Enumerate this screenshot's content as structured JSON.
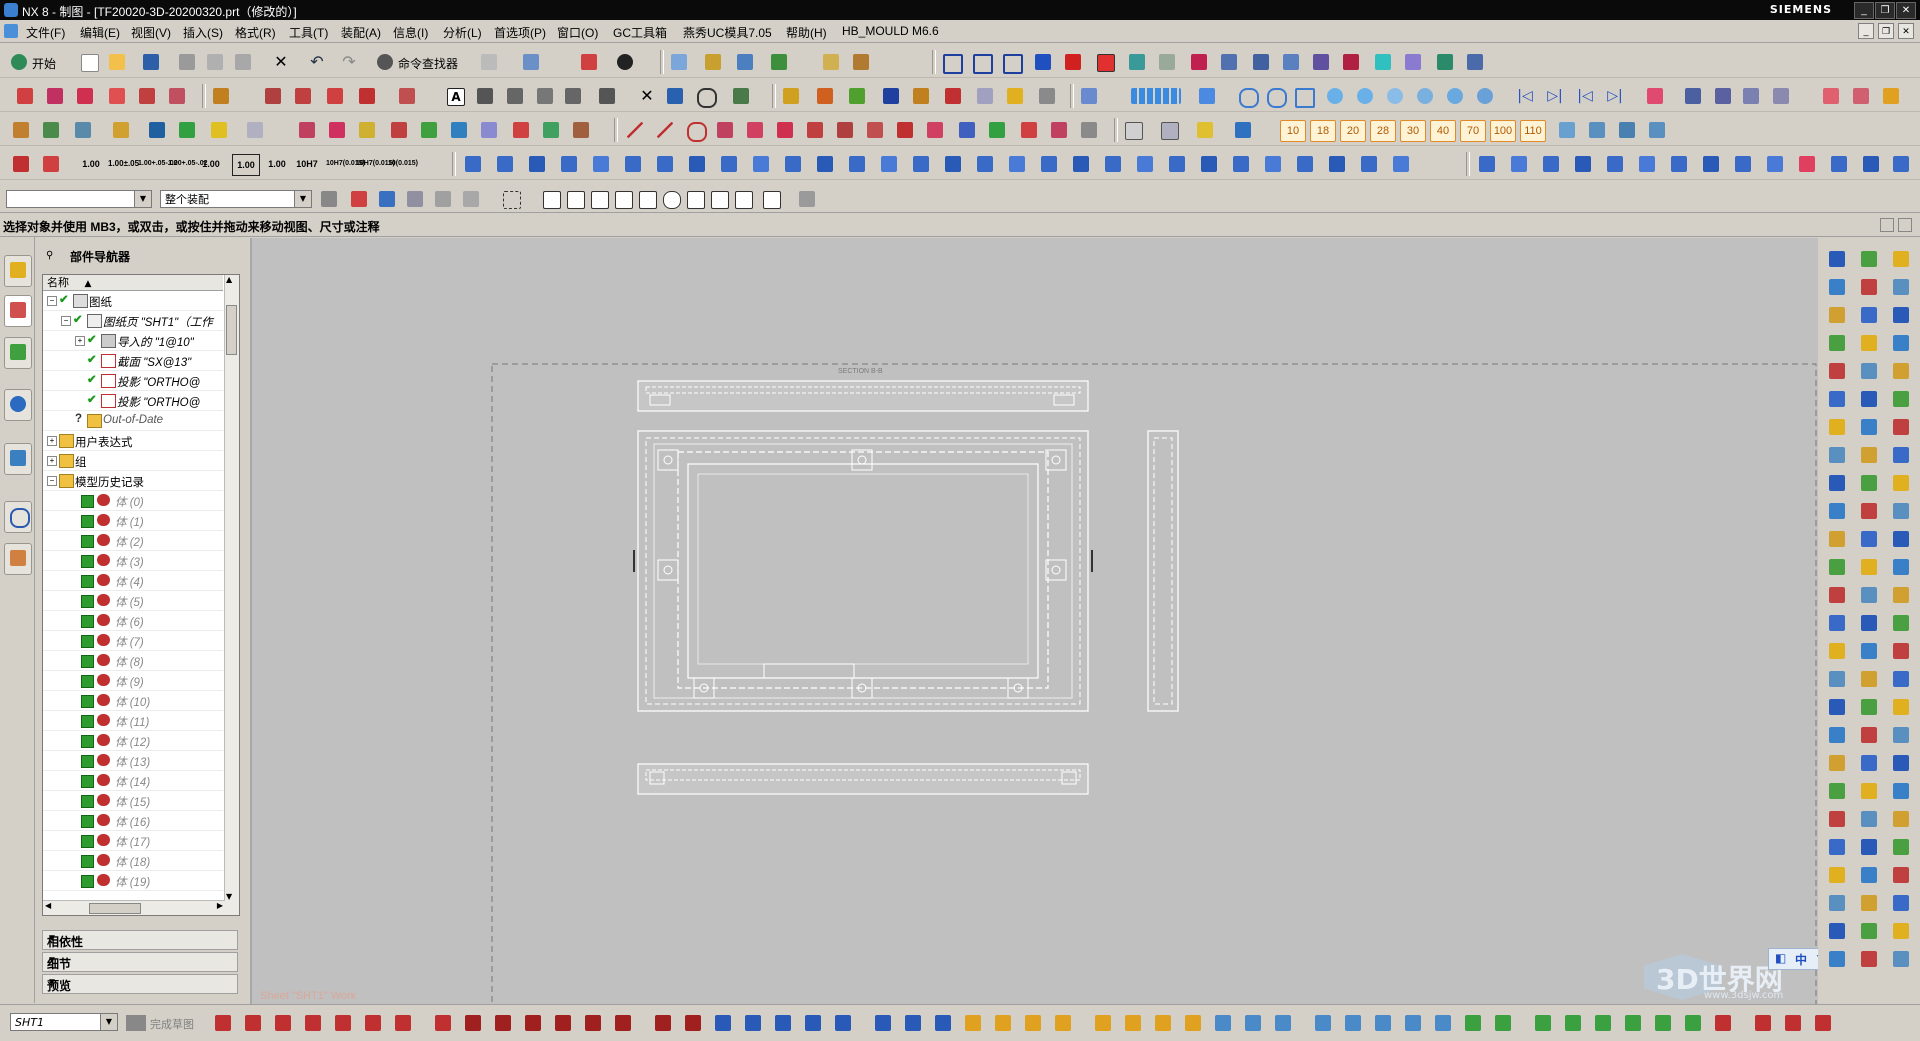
{
  "titlebar": {
    "title": "NX 8 - 制图 - [TF20020-3D-20200320.prt（修改的）]",
    "brand": "SIEMENS",
    "min": "_",
    "restore": "❐",
    "close": "✕"
  },
  "menu": {
    "items": [
      "文件(F)",
      "编辑(E)",
      "视图(V)",
      "插入(S)",
      "格式(R)",
      "工具(T)",
      "装配(A)",
      "信息(I)",
      "分析(L)",
      "首选项(P)",
      "窗口(O)",
      "GC工具箱",
      "燕秀UC模具7.05",
      "帮助(H)",
      "HB_MOULD M6.6"
    ],
    "mdi": [
      "_",
      "❐",
      "✕"
    ]
  },
  "toolbar1": {
    "start_label": "开始",
    "finder_label": "命令查找器"
  },
  "toolbar4": {
    "tol": [
      "1.00",
      "1.00±.05",
      "1.00+.05-.02",
      "1.00+.05-.02",
      "1.00",
      "1.00",
      "1.00",
      "10H7",
      "10H7(0.015)",
      "10H7(0.015)",
      "10(0.015)"
    ]
  },
  "toolbar2_numbers": [
    "10",
    "18",
    "20",
    "28",
    "30",
    "40",
    "70",
    "100",
    "110"
  ],
  "selbar": {
    "filter": "",
    "scope": "整个装配"
  },
  "status": {
    "prompt": "选择对象并使用 MB3，或双击，或按住并拖动来移动视图、尺寸或注释"
  },
  "navigator": {
    "title": "部件导航器",
    "column": "名称",
    "rows": [
      {
        "label": "图纸",
        "level": 0
      },
      {
        "label": "图纸页 \"SHT1\"（工作",
        "level": 1
      },
      {
        "label": "导入的 \"1@10\"",
        "level": 2
      },
      {
        "label": "截面 \"SX@13\"",
        "level": 2
      },
      {
        "label": "投影 \"ORTHO@",
        "level": 2
      },
      {
        "label": "投影 \"ORTHO@",
        "level": 2
      },
      {
        "label": "Out-of-Date",
        "level": 1
      },
      {
        "label": "用户表达式",
        "level": 0
      },
      {
        "label": "组",
        "level": 0
      },
      {
        "label": "模型历史记录",
        "level": 0
      }
    ],
    "bodies": [
      "体 (0)",
      "体 (1)",
      "体 (2)",
      "体 (3)",
      "体 (4)",
      "体 (5)",
      "体 (6)",
      "体 (7)",
      "体 (8)",
      "体 (9)",
      "体 (10)",
      "体 (11)",
      "体 (12)",
      "体 (13)",
      "体 (14)",
      "体 (15)",
      "体 (16)",
      "体 (17)",
      "体 (18)",
      "体 (19)"
    ],
    "panels": [
      "相依性",
      "细节",
      "预览"
    ]
  },
  "drawing": {
    "section_label": "SECTION B-B",
    "sheet_label": "Sheet \"SHT1\" Work"
  },
  "bottombar": {
    "sheet": "SHT1",
    "finish_sketch": "完成草图"
  },
  "watermark": {
    "text": "3D世界网",
    "url": "www.3dsjw.com"
  },
  "colors": {
    "canvas": "#c0c0c0",
    "ui": "#d4d0c8",
    "titlebar": "#0a0a0a",
    "check": "#2e9b2e"
  }
}
